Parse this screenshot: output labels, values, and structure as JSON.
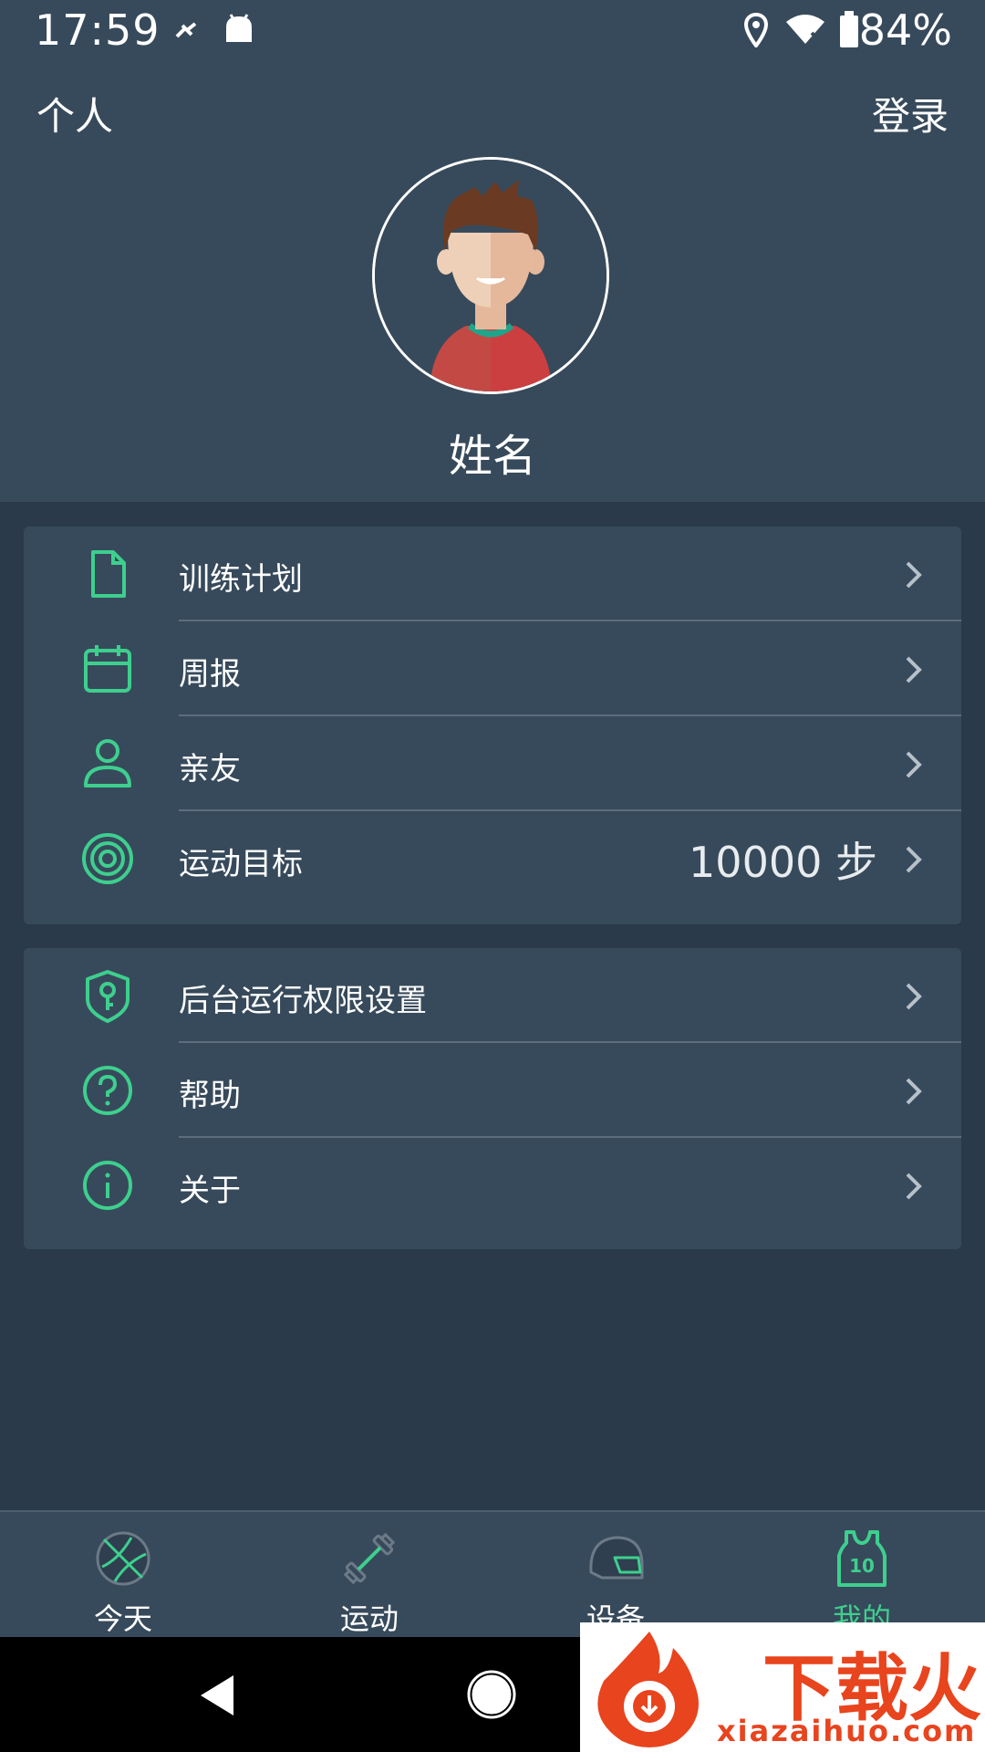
{
  "status_bar": {
    "time": "17:59",
    "battery": "84%"
  },
  "header": {
    "title": "个人",
    "login": "登录",
    "name": "姓名"
  },
  "menu1": [
    {
      "label": "训练计划",
      "icon": "file-icon"
    },
    {
      "label": "周报",
      "icon": "calendar-icon"
    },
    {
      "label": "亲友",
      "icon": "person-icon"
    },
    {
      "label": "运动目标",
      "icon": "target-icon",
      "value": "10000 步"
    }
  ],
  "menu2": [
    {
      "label": "后台运行权限设置",
      "icon": "shield-key-icon"
    },
    {
      "label": "帮助",
      "icon": "help-icon"
    },
    {
      "label": "关于",
      "icon": "info-icon"
    }
  ],
  "bottom_nav": [
    {
      "label": "今天",
      "icon": "basketball-icon",
      "active": false
    },
    {
      "label": "运动",
      "icon": "dumbbell-icon",
      "active": false
    },
    {
      "label": "设备",
      "icon": "helmet-icon",
      "active": false
    },
    {
      "label": "我的",
      "icon": "jersey-icon",
      "active": true,
      "badge": "10"
    }
  ],
  "watermark": {
    "brand": "下载火",
    "url": "xiazaihuo.com"
  },
  "colors": {
    "accent": "#3ecf8e",
    "background": "#2a3a4a",
    "panel": "#374a5b"
  }
}
